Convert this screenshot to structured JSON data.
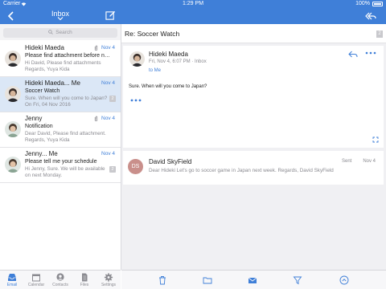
{
  "status_bar": {
    "carrier": "Carrier",
    "time": "1:29 PM",
    "battery": "100%"
  },
  "nav": {
    "title": "Inbox",
    "back_icon": "chevron-left-icon",
    "compose_icon": "compose-icon",
    "reply_all_icon": "reply-all-icon"
  },
  "search": {
    "placeholder": "Search"
  },
  "mail_list": [
    {
      "sender": "Hideki Maeda",
      "date": "Nov 4",
      "subject": "Please find attachment before n…",
      "preview": "Hi David, Please find attachments Regards, Yuya Kida",
      "attachment": true,
      "count": ""
    },
    {
      "sender": "Hideki Maeda... Me",
      "date": "Nov 4",
      "subject": "Soccer Watch",
      "preview": "Sure. When will you come to Japan? On Fri, 04 Nov 2016",
      "attachment": false,
      "count": "2"
    },
    {
      "sender": "Jenny",
      "date": "Nov 4",
      "subject": "Notification",
      "preview": "Dear David, Please find attachment. Regards, Yuya Kida",
      "attachment": true,
      "count": ""
    },
    {
      "sender": "Jenny... Me",
      "date": "Nov 4",
      "subject": "Please tell me your schedule",
      "preview": "Hi Jenny, Sure. We will be available on next Monday.",
      "attachment": false,
      "count": "2"
    }
  ],
  "detail": {
    "subject": "Re: Soccer Watch",
    "count": "2",
    "message1": {
      "sender": "Hideki Maeda",
      "meta": "Fri, Nov 4, 6:07 PM  ·  Inbox",
      "to": "to Me",
      "body": "Sure. When will you come to Japan?"
    },
    "message2": {
      "initials": "DS",
      "sender": "David SkyField",
      "status": "Sent",
      "date": "Nov 4",
      "preview": "Dear Hideki Let's go to soccer game in Japan next week. Regards, David SkyField"
    }
  },
  "tabs": [
    {
      "label": "Email",
      "icon": "inbox-tray-icon"
    },
    {
      "label": "Calendar",
      "icon": "calendar-icon"
    },
    {
      "label": "Contacts",
      "icon": "contacts-icon"
    },
    {
      "label": "Files",
      "icon": "files-icon"
    },
    {
      "label": "Settings",
      "icon": "gear-icon"
    }
  ],
  "toolbar": [
    "trash-icon",
    "folder-icon",
    "envelope-icon",
    "filter-icon",
    "chevron-up-circle-icon"
  ],
  "colors": {
    "accent": "#3f7fd8",
    "selected_row": "#dbe7f6",
    "pane_bg": "#f0f0f3",
    "avatar_ds": "#c98f8b"
  }
}
